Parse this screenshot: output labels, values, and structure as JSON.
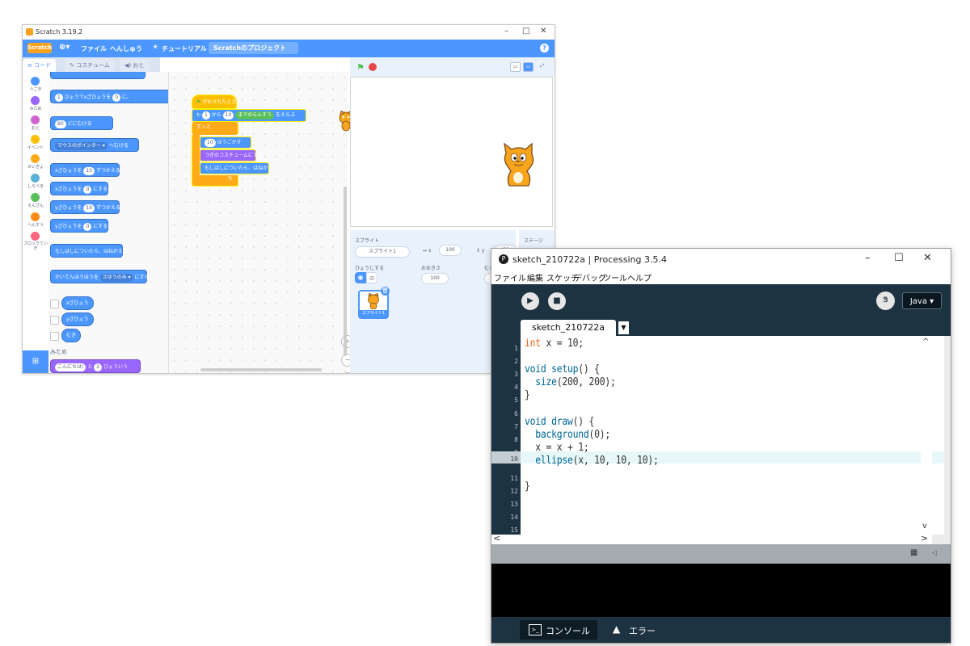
{
  "scratch": {
    "window_title": "Scratch 3.19.2",
    "brand": "Scratch",
    "menu": [
      "ファイル",
      "へんしゅう",
      "チュートリアル"
    ],
    "project_title": "Scratchのプロジェクト",
    "tabs": [
      "コード",
      "コスチューム",
      "おと"
    ],
    "categories": [
      {
        "label": "うごき",
        "color": "#4c97ff"
      },
      {
        "label": "みため",
        "color": "#9966ff"
      },
      {
        "label": "おと",
        "color": "#cf63cf"
      },
      {
        "label": "イベント",
        "color": "#ffbf00"
      },
      {
        "label": "せいぎょ",
        "color": "#ffab19"
      },
      {
        "label": "しらべる",
        "color": "#5cb1d6"
      },
      {
        "label": "えんざん",
        "color": "#59c059"
      },
      {
        "label": "へんすう",
        "color": "#ff8c1a"
      },
      {
        "label": "ブロックていぎ",
        "color": "#ff6680"
      }
    ],
    "palette": {
      "glide_pre": "びょうでxざひょうを",
      "glide_v1": "1",
      "glide_v2": "0",
      "point_v": "90",
      "point_post": "どにむける",
      "pointer": "マウスのポインター ▾",
      "pointer_post": "へむける",
      "cx_pre": "xざひょうを",
      "cx_v": "10",
      "cx_post": "ずつかえる",
      "sx_pre": "xざひょうを",
      "sx_v": "0",
      "sx_post": "にする",
      "cy_pre": "yざひょうを",
      "cy_v": "10",
      "cy_post": "ずつかえる",
      "sy_pre": "yざひょうを",
      "sy_v": "0",
      "sy_post": "にする",
      "bounce": "もしはしについたら、はねかえる",
      "rot": "かいてんほうほうを",
      "rot_v": "さゆうのみ ▾",
      "rot_post": "にする",
      "rep_x": "xざひょう",
      "rep_y": "yざひょう",
      "rep_dir": "むき",
      "looks_header": "みため",
      "say_v1": "こんにちは!",
      "say_mid": "と",
      "say_v2": "2",
      "say_post": "びょういう"
    },
    "script": {
      "hat": "がおされたとき",
      "repeat_from": "1",
      "repeat_kara": "から",
      "repeat_to": "10",
      "repeat_post": "までのらんすう",
      "repeat_end": "をえらぶ",
      "forever": "ずっと",
      "move_v": "10",
      "move_post": "ほうごかす",
      "next_costume": "つぎのコスチュームにする",
      "bounce": "もしはしについたら、はねかえる"
    },
    "sprite_panel": {
      "sprite_label": "スプライト",
      "sprite_name": "スプライト1",
      "x_label": "x",
      "x_value": "100",
      "y_label": "y",
      "y_value": "-22",
      "show_label": "ひょうじする",
      "size_label": "おおきさ",
      "size_value": "100",
      "direction_label": "むき",
      "stage_label": "ステージ",
      "thumb_name": "スプライト1"
    }
  },
  "processing": {
    "window_title": "sketch_210722a | Processing 3.5.4",
    "menu": [
      "ファイル",
      "編集",
      "スケッチ",
      "デバッグ",
      "ツール",
      "ヘルプ"
    ],
    "mode": "Java ▾",
    "tab_name": "sketch_210722a",
    "line_numbers": [
      "1",
      "2",
      "3",
      "4",
      "5",
      "6",
      "7",
      "8",
      "9",
      "10",
      "11",
      "12",
      "13",
      "14",
      "15",
      "16"
    ],
    "current_line": "10",
    "code": {
      "l1_kw": "int",
      "l1_rest": " x = 10;",
      "l3_kw": "void",
      "l3_fn": "setup",
      "l3_rest": "() {",
      "l4_fn": "size",
      "l4_rest": "(200, 200);",
      "l5": "}",
      "l7_kw": "void",
      "l7_fn": "draw",
      "l7_rest": "() {",
      "l8_fn": "background",
      "l8_rest": "(0);",
      "l9": "x = x + 1;",
      "l10_fn": "ellipse",
      "l10_rest": "(x, 10, 10, 10);",
      "l12": "}"
    },
    "footer": {
      "console": "コンソール",
      "errors": "エラー"
    }
  }
}
